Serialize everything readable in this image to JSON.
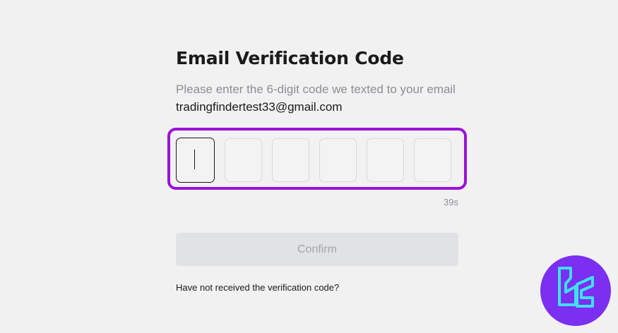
{
  "verification": {
    "title": "Email Verification Code",
    "instruction": "Please enter the 6-digit code we texted to your email",
    "email": "tradingfindertest33@gmail.com",
    "code_digits": [
      "",
      "",
      "",
      "",
      "",
      ""
    ],
    "timer": "39s",
    "confirm_label": "Confirm",
    "resend_text": "Have not received the verification code?"
  },
  "colors": {
    "background": "#f1f1f2",
    "highlight_border": "#9b12d6",
    "confirm_bg": "#e1e2e4",
    "logo_bg": "#7b2ff0",
    "logo_accent": "#3fe0f0"
  },
  "icons": {
    "logo": "tradingfinder-logo-icon"
  }
}
